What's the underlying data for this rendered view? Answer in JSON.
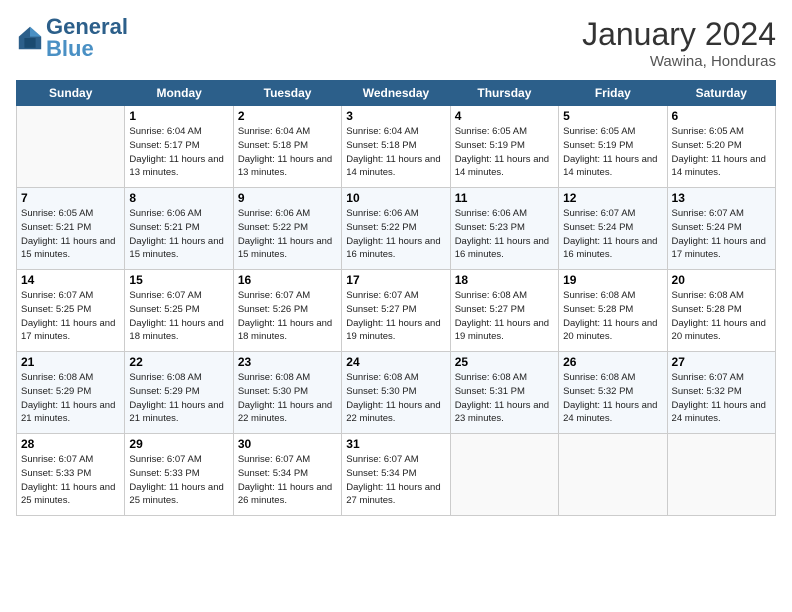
{
  "header": {
    "logo_general": "General",
    "logo_blue": "Blue",
    "month_year": "January 2024",
    "location": "Wawina, Honduras"
  },
  "days_of_week": [
    "Sunday",
    "Monday",
    "Tuesday",
    "Wednesday",
    "Thursday",
    "Friday",
    "Saturday"
  ],
  "weeks": [
    [
      {
        "day": "",
        "sunrise": "",
        "sunset": "",
        "daylight": "",
        "empty": true
      },
      {
        "day": "1",
        "sunrise": "Sunrise: 6:04 AM",
        "sunset": "Sunset: 5:17 PM",
        "daylight": "Daylight: 11 hours and 13 minutes."
      },
      {
        "day": "2",
        "sunrise": "Sunrise: 6:04 AM",
        "sunset": "Sunset: 5:18 PM",
        "daylight": "Daylight: 11 hours and 13 minutes."
      },
      {
        "day": "3",
        "sunrise": "Sunrise: 6:04 AM",
        "sunset": "Sunset: 5:18 PM",
        "daylight": "Daylight: 11 hours and 14 minutes."
      },
      {
        "day": "4",
        "sunrise": "Sunrise: 6:05 AM",
        "sunset": "Sunset: 5:19 PM",
        "daylight": "Daylight: 11 hours and 14 minutes."
      },
      {
        "day": "5",
        "sunrise": "Sunrise: 6:05 AM",
        "sunset": "Sunset: 5:19 PM",
        "daylight": "Daylight: 11 hours and 14 minutes."
      },
      {
        "day": "6",
        "sunrise": "Sunrise: 6:05 AM",
        "sunset": "Sunset: 5:20 PM",
        "daylight": "Daylight: 11 hours and 14 minutes."
      }
    ],
    [
      {
        "day": "7",
        "sunrise": "Sunrise: 6:05 AM",
        "sunset": "Sunset: 5:21 PM",
        "daylight": "Daylight: 11 hours and 15 minutes."
      },
      {
        "day": "8",
        "sunrise": "Sunrise: 6:06 AM",
        "sunset": "Sunset: 5:21 PM",
        "daylight": "Daylight: 11 hours and 15 minutes."
      },
      {
        "day": "9",
        "sunrise": "Sunrise: 6:06 AM",
        "sunset": "Sunset: 5:22 PM",
        "daylight": "Daylight: 11 hours and 15 minutes."
      },
      {
        "day": "10",
        "sunrise": "Sunrise: 6:06 AM",
        "sunset": "Sunset: 5:22 PM",
        "daylight": "Daylight: 11 hours and 16 minutes."
      },
      {
        "day": "11",
        "sunrise": "Sunrise: 6:06 AM",
        "sunset": "Sunset: 5:23 PM",
        "daylight": "Daylight: 11 hours and 16 minutes."
      },
      {
        "day": "12",
        "sunrise": "Sunrise: 6:07 AM",
        "sunset": "Sunset: 5:24 PM",
        "daylight": "Daylight: 11 hours and 16 minutes."
      },
      {
        "day": "13",
        "sunrise": "Sunrise: 6:07 AM",
        "sunset": "Sunset: 5:24 PM",
        "daylight": "Daylight: 11 hours and 17 minutes."
      }
    ],
    [
      {
        "day": "14",
        "sunrise": "Sunrise: 6:07 AM",
        "sunset": "Sunset: 5:25 PM",
        "daylight": "Daylight: 11 hours and 17 minutes."
      },
      {
        "day": "15",
        "sunrise": "Sunrise: 6:07 AM",
        "sunset": "Sunset: 5:25 PM",
        "daylight": "Daylight: 11 hours and 18 minutes."
      },
      {
        "day": "16",
        "sunrise": "Sunrise: 6:07 AM",
        "sunset": "Sunset: 5:26 PM",
        "daylight": "Daylight: 11 hours and 18 minutes."
      },
      {
        "day": "17",
        "sunrise": "Sunrise: 6:07 AM",
        "sunset": "Sunset: 5:27 PM",
        "daylight": "Daylight: 11 hours and 19 minutes."
      },
      {
        "day": "18",
        "sunrise": "Sunrise: 6:08 AM",
        "sunset": "Sunset: 5:27 PM",
        "daylight": "Daylight: 11 hours and 19 minutes."
      },
      {
        "day": "19",
        "sunrise": "Sunrise: 6:08 AM",
        "sunset": "Sunset: 5:28 PM",
        "daylight": "Daylight: 11 hours and 20 minutes."
      },
      {
        "day": "20",
        "sunrise": "Sunrise: 6:08 AM",
        "sunset": "Sunset: 5:28 PM",
        "daylight": "Daylight: 11 hours and 20 minutes."
      }
    ],
    [
      {
        "day": "21",
        "sunrise": "Sunrise: 6:08 AM",
        "sunset": "Sunset: 5:29 PM",
        "daylight": "Daylight: 11 hours and 21 minutes."
      },
      {
        "day": "22",
        "sunrise": "Sunrise: 6:08 AM",
        "sunset": "Sunset: 5:29 PM",
        "daylight": "Daylight: 11 hours and 21 minutes."
      },
      {
        "day": "23",
        "sunrise": "Sunrise: 6:08 AM",
        "sunset": "Sunset: 5:30 PM",
        "daylight": "Daylight: 11 hours and 22 minutes."
      },
      {
        "day": "24",
        "sunrise": "Sunrise: 6:08 AM",
        "sunset": "Sunset: 5:30 PM",
        "daylight": "Daylight: 11 hours and 22 minutes."
      },
      {
        "day": "25",
        "sunrise": "Sunrise: 6:08 AM",
        "sunset": "Sunset: 5:31 PM",
        "daylight": "Daylight: 11 hours and 23 minutes."
      },
      {
        "day": "26",
        "sunrise": "Sunrise: 6:08 AM",
        "sunset": "Sunset: 5:32 PM",
        "daylight": "Daylight: 11 hours and 24 minutes."
      },
      {
        "day": "27",
        "sunrise": "Sunrise: 6:07 AM",
        "sunset": "Sunset: 5:32 PM",
        "daylight": "Daylight: 11 hours and 24 minutes."
      }
    ],
    [
      {
        "day": "28",
        "sunrise": "Sunrise: 6:07 AM",
        "sunset": "Sunset: 5:33 PM",
        "daylight": "Daylight: 11 hours and 25 minutes."
      },
      {
        "day": "29",
        "sunrise": "Sunrise: 6:07 AM",
        "sunset": "Sunset: 5:33 PM",
        "daylight": "Daylight: 11 hours and 25 minutes."
      },
      {
        "day": "30",
        "sunrise": "Sunrise: 6:07 AM",
        "sunset": "Sunset: 5:34 PM",
        "daylight": "Daylight: 11 hours and 26 minutes."
      },
      {
        "day": "31",
        "sunrise": "Sunrise: 6:07 AM",
        "sunset": "Sunset: 5:34 PM",
        "daylight": "Daylight: 11 hours and 27 minutes."
      },
      {
        "day": "",
        "sunrise": "",
        "sunset": "",
        "daylight": "",
        "empty": true
      },
      {
        "day": "",
        "sunrise": "",
        "sunset": "",
        "daylight": "",
        "empty": true
      },
      {
        "day": "",
        "sunrise": "",
        "sunset": "",
        "daylight": "",
        "empty": true
      }
    ]
  ]
}
